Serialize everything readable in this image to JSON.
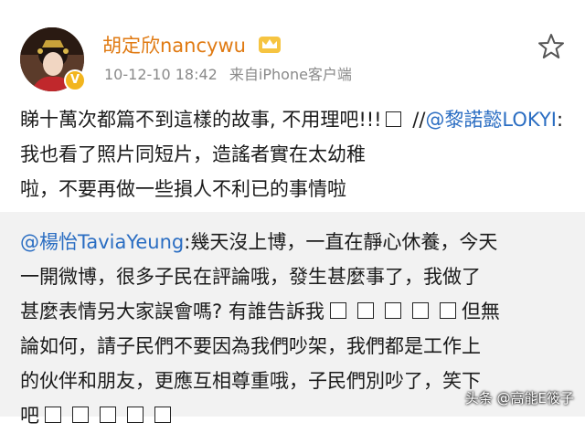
{
  "user": {
    "name": "胡定欣nancywu",
    "time": "10-12-10 18:42",
    "source": "来自iPhone客户端",
    "verified_badge": "V",
    "crown_icon": "crown-icon",
    "star_icon": "star-outline-icon"
  },
  "post": {
    "line1": "睇十萬次都篇不到這樣的故事, 不用理吧!!!",
    "repost_sep": " //",
    "mention1": "@黎諾懿LOKYI",
    "line2": ":我也看了照片同短片，造謠者實在太幼稚",
    "line3": "啦，不要再做一些損人不利已的事情啦"
  },
  "repost": {
    "mention": "@楊怡TaviaYeung",
    "part1": ":幾天沒上博，一直在靜心休養，今天",
    "line2": "一開微博，很多子民在評論哦，發生甚麼事了，我做了",
    "line3": "甚麼表情另大家誤會嗎? 有誰告訴我",
    "line3b": "但無",
    "line4": "論如何，請子民們不要因為我們吵架，我們都是工作上",
    "line5": "的伙伴和朋友，更應互相尊重哦，子民們別吵了，笑下",
    "line6": "吧"
  },
  "watermark": "头条 @高能E筱子",
  "colors": {
    "username": "#e07a12",
    "mention": "#2a6dc2",
    "repost_bg": "#f2f2f2",
    "badge": "#f2b51e"
  }
}
